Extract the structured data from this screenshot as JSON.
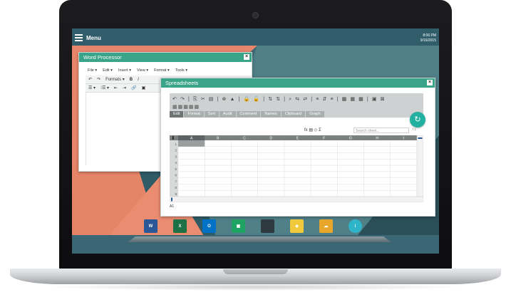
{
  "taskbar": {
    "menu_label": "Menu",
    "clock_time": "8:06 PM",
    "clock_date": "9/16/2015"
  },
  "word_processor": {
    "title": "Word Processor",
    "close": "×",
    "menus": [
      "File ▾",
      "Edit ▾",
      "Insert ▾",
      "View ▾",
      "Format ▾",
      "Tools ▾"
    ],
    "toolbar1": [
      "↶",
      "↷",
      "Formats ▾",
      "B",
      "I"
    ],
    "toolbar2": [
      "☰ ▾",
      "⁝☰ ▾",
      "⇤",
      "⇥",
      "🔗",
      "▣"
    ]
  },
  "spreadsheets": {
    "title": "Spreadsheets",
    "close": "×",
    "toolbar_icons": "↶ ↷ | ⎘ ✂ ▤ | ⊗ ▲ | 🔒 🔓 | ⇅ ⇅ | ⌕ ⇆ ⇄ | ≡ ⇵ ≡ | ▦ ▦ ▦ | ▣ ⊠",
    "toolbar_icons2": "▦▦▦▦▦",
    "tabs": [
      {
        "label": "Edit",
        "active": true
      },
      {
        "label": "Format",
        "active": false
      },
      {
        "label": "Sort",
        "active": false
      },
      {
        "label": "Audit",
        "active": false
      },
      {
        "label": "Comment",
        "active": false
      },
      {
        "label": "Names",
        "active": false
      },
      {
        "label": "Clipboard",
        "active": false
      },
      {
        "label": "Graph",
        "active": false
      }
    ],
    "refresh_icon": "↻",
    "formula_icons": "fx ▤ ◇ Σ",
    "search_placeholder": "Search sheet...",
    "sort_arrows": "↑↓",
    "corner": "⬇",
    "columns": [
      "A",
      "B",
      "C",
      "D",
      "E",
      "F",
      "G",
      "H",
      "I"
    ],
    "rows": [
      "1",
      "2",
      "3",
      "4",
      "5",
      "6",
      "7",
      "8",
      "9"
    ],
    "cell_ref": "A1"
  },
  "dock": {
    "icons": [
      {
        "name": "word-app-icon",
        "glyph": "W",
        "color": "#2b5797"
      },
      {
        "name": "excel-app-icon",
        "glyph": "X",
        "color": "#1e7145"
      },
      {
        "name": "outlook-app-icon",
        "glyph": "O",
        "color": "#0072c6"
      },
      {
        "name": "image-viewer-app-icon",
        "glyph": "▣",
        "color": "#1ea362"
      },
      {
        "name": "terminal-app-icon",
        "glyph": "",
        "color": "#2e3a3f"
      },
      {
        "name": "maps-app-icon",
        "glyph": "◆",
        "color": "#f0c93c"
      },
      {
        "name": "cloud-drive-app-icon",
        "glyph": "☁",
        "color": "#e8a72b"
      },
      {
        "name": "info-app-icon",
        "glyph": "i",
        "color": "#2fb5c9"
      }
    ]
  },
  "colors": {
    "window_title": "#3aa48a",
    "wallpaper_orange": "#e8866b",
    "wallpaper_teal": "#3e6a78",
    "taskbar": "#315d6b"
  }
}
